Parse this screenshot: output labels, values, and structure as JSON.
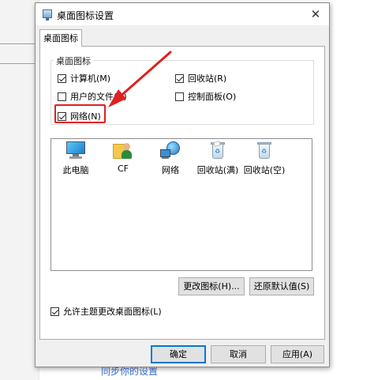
{
  "background": {
    "link_text": "同步你的设置"
  },
  "dialog": {
    "title": "桌面图标设置",
    "close_symbol": "✕",
    "tab_label": "桌面图标",
    "group_title": "桌面图标",
    "checkboxes": {
      "computer": {
        "label": "计算机(M)",
        "checked": true
      },
      "recycle_bin": {
        "label": "回收站(R)",
        "checked": true
      },
      "user_files": {
        "label": "用户的文件(U)",
        "checked": false
      },
      "control_panel": {
        "label": "控制面板(O)",
        "checked": false
      },
      "network": {
        "label": "网络(N)",
        "checked": true
      }
    },
    "icons": [
      {
        "label": "此电脑",
        "icon": "computer-icon"
      },
      {
        "label": "CF",
        "icon": "user-folder-icon"
      },
      {
        "label": "网络",
        "icon": "network-icon"
      },
      {
        "label": "回收站(满)",
        "icon": "recycle-bin-full-icon"
      },
      {
        "label": "回收站(空)",
        "icon": "recycle-bin-empty-icon"
      }
    ],
    "change_icon_button": "更改图标(H)...",
    "restore_default_button": "还原默认值(S)",
    "allow_themes_checkbox": {
      "label": "允许主题更改桌面图标(L)",
      "checked": true
    },
    "ok_button": "确定",
    "cancel_button": "取消",
    "apply_button": "应用(A)"
  },
  "colors": {
    "annotation_red": "#e02020",
    "accent_blue": "#0078d7"
  }
}
